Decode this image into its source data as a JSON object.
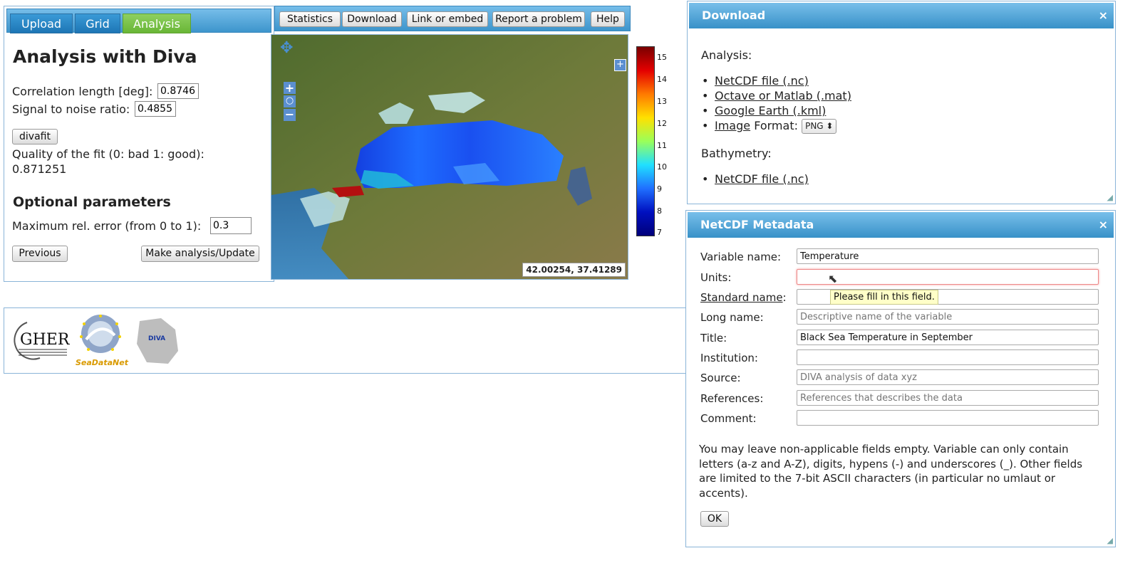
{
  "tabs": [
    {
      "label": "Upload",
      "active": false
    },
    {
      "label": "Grid",
      "active": false
    },
    {
      "label": "Analysis",
      "active": true
    }
  ],
  "analysis": {
    "title": "Analysis with Diva",
    "correlation_label": "Correlation length [deg]:",
    "correlation_value": "0.87463",
    "snr_label": "Signal to noise ratio:",
    "snr_value": "0.48557",
    "divafit_label": "divafit",
    "quality_label": "Quality of the fit (0: bad 1: good):",
    "quality_value": "0.871251",
    "optional_title": "Optional parameters",
    "max_error_label": "Maximum rel. error (from 0 to 1):",
    "max_error_value": "0.3",
    "previous_label": "Previous",
    "update_label": "Make analysis/Update"
  },
  "toolbar": {
    "statistics": "Statistics",
    "download": "Download",
    "link": "Link or embed",
    "report": "Report a problem",
    "help": "Help"
  },
  "map": {
    "coords": "42.00254, 37.41289",
    "colorbar_ticks": [
      "15",
      "14",
      "13",
      "12",
      "11",
      "10",
      "9",
      "8",
      "7"
    ]
  },
  "logos": {
    "gher": "GHER",
    "seadatanet": "SeaDataNet",
    "diva": "DIVA"
  },
  "download_dialog": {
    "title": "Download",
    "close": "×",
    "analysis_heading": "Analysis:",
    "items": [
      "NetCDF file (.nc)",
      "Octave or Matlab (.mat)",
      "Google Earth (.kml)"
    ],
    "image_link": "Image",
    "format_label": "Format:",
    "format_value": "PNG",
    "bathymetry_heading": "Bathymetry:",
    "bathy_item": "NetCDF file (.nc)"
  },
  "metadata_dialog": {
    "title": "NetCDF Metadata",
    "close": "×",
    "fields": {
      "variable_label": "Variable name:",
      "variable_value": "Temperature",
      "units_label": "Units:",
      "standard_label": "Standard name",
      "standard_colon": ":",
      "long_label": "Long name:",
      "long_placeholder": "Descriptive name of the variable",
      "title_label": "Title:",
      "title_value": "Black Sea Temperature in September",
      "institution_label": "Institution:",
      "source_label": "Source:",
      "source_placeholder": "DIVA analysis of data xyz",
      "references_label": "References:",
      "references_placeholder": "References that describes the data",
      "comment_label": "Comment:"
    },
    "tooltip": "Please fill in this field.",
    "note": "You may leave non-applicable fields empty. Variable can only contain letters (a-z and A-Z), digits, hypens (-) and underscores (_). Other fields are limited to the 7-bit ASCII characters (in particular no umlaut or accents).",
    "ok_label": "OK"
  }
}
